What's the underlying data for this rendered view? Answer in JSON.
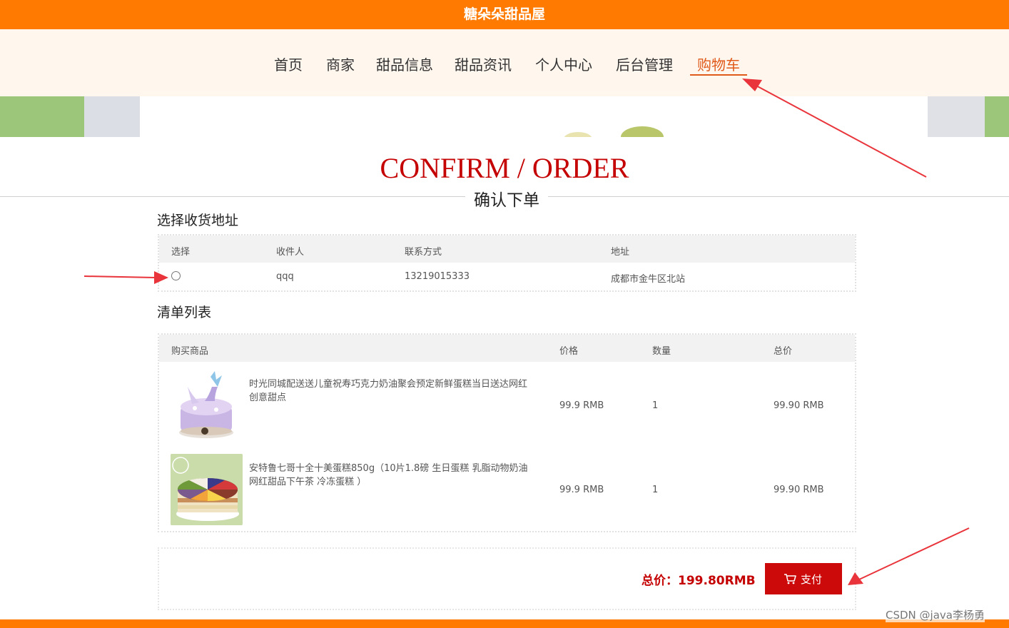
{
  "header": {
    "site_title": "糖朵朵甜品屋"
  },
  "nav": {
    "items": [
      {
        "label": "首页"
      },
      {
        "label": "商家"
      },
      {
        "label": "甜品信息"
      },
      {
        "label": "甜品资讯"
      },
      {
        "label": "个人中心"
      },
      {
        "label": "后台管理"
      },
      {
        "label": "购物车"
      }
    ],
    "active": "购物车"
  },
  "page": {
    "heading_en": "CONFIRM / ORDER",
    "heading_zh": "确认下单"
  },
  "address_section": {
    "title": "选择收货地址",
    "columns": [
      "选择",
      "收件人",
      "联系方式",
      "地址"
    ],
    "rows": [
      {
        "selected": false,
        "recipient": "qqq",
        "phone": "13219015333",
        "address": "成都市金牛区北站"
      }
    ]
  },
  "order_section": {
    "title": "清单列表",
    "columns": [
      "购买商品",
      "价格",
      "数量",
      "总价"
    ],
    "rows": [
      {
        "name": "时光同城配送送儿童祝寿巧克力奶油聚会预定新鲜蛋糕当日送达网红创意甜点",
        "price": "99.9 RMB",
        "quantity": "1",
        "total": "99.90 RMB"
      },
      {
        "name": "安特鲁七哥十全十美蛋糕850g（10片1.8磅 生日蛋糕 乳脂动物奶油 网红甜品下午茶 冷冻蛋糕 ）",
        "price": "99.9 RMB",
        "quantity": "1",
        "total": "99.90 RMB"
      }
    ]
  },
  "summary": {
    "total_label": "总价：199.80RMB",
    "pay_label": "支付"
  },
  "icons": {
    "pay": "cart-icon"
  },
  "colors": {
    "brand_orange": "#ff7a00",
    "accent_red": "#c40000",
    "nav_active": "#e05a1a",
    "pay_button": "#cc0a0a",
    "annotation_arrow": "#e8343a"
  },
  "watermark": "CSDN @java李杨勇"
}
